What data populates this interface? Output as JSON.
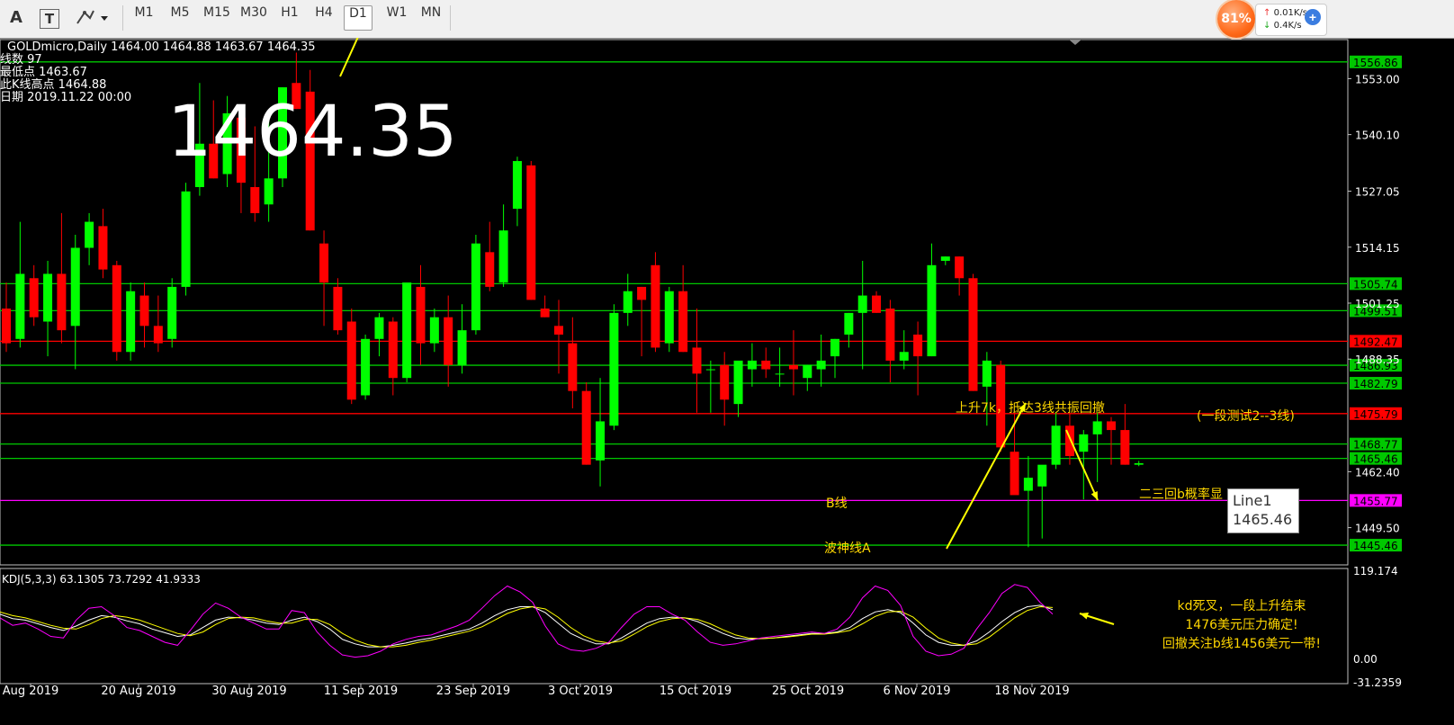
{
  "toolbar": {
    "text_tool_a": "A",
    "text_tool_t": "T",
    "timeframes": [
      "M1",
      "M5",
      "M15",
      "M30",
      "H1",
      "H4",
      "D1",
      "W1",
      "MN"
    ],
    "active_timeframe": "D1",
    "cpu_percent": "81%",
    "upload_rate": "0.01K/s",
    "download_rate": "0.4K/s",
    "plus": "+"
  },
  "info": {
    "symbol_line": "GOLDmicro,Daily  1464.00 1464.88 1463.67 1464.35",
    "line2": "线数  97",
    "line3": "最低点 1463.67",
    "line4": "此K线高点 1464.88",
    "line5": "日期 2019.11.22 00:00",
    "big_price": "1464.35"
  },
  "chart_data": [
    {
      "type": "candlestick",
      "symbol": "GOLDmicro",
      "period": "Daily",
      "ylim": [
        1440.5,
        1562.0
      ],
      "price_axis_ticks": [
        "1553.00",
        "1540.10",
        "1527.05",
        "1514.15",
        "1501.25",
        "1488.35",
        "1462.40",
        "1449.50"
      ],
      "date_labels": [
        {
          "index": 1,
          "label": "Aug 2019"
        },
        {
          "index": 9,
          "label": "20 Aug 2019"
        },
        {
          "index": 17,
          "label": "30 Aug 2019"
        },
        {
          "index": 25,
          "label": "11 Sep 2019"
        },
        {
          "index": 33,
          "label": "23 Sep 2019"
        },
        {
          "index": 41,
          "label": "3 Oct 2019"
        },
        {
          "index": 49,
          "label": "15 Oct 2019"
        },
        {
          "index": 57,
          "label": "25 Oct 2019"
        },
        {
          "index": 65,
          "label": "6 Nov 2019"
        },
        {
          "index": 73,
          "label": "18 Nov 2019"
        }
      ],
      "ohlc": [
        [
          1500,
          1506,
          1490,
          1492
        ],
        [
          1493,
          1520,
          1491,
          1508
        ],
        [
          1507,
          1510,
          1496,
          1498
        ],
        [
          1497,
          1511,
          1489,
          1508
        ],
        [
          1508,
          1522,
          1492,
          1495
        ],
        [
          1496,
          1517,
          1486,
          1514
        ],
        [
          1514,
          1522,
          1510,
          1520
        ],
        [
          1519,
          1523,
          1507,
          1509
        ],
        [
          1510,
          1511,
          1488,
          1490
        ],
        [
          1490,
          1506,
          1488,
          1504
        ],
        [
          1503,
          1506,
          1491,
          1496
        ],
        [
          1496,
          1503,
          1490,
          1492
        ],
        [
          1493,
          1507,
          1491,
          1505
        ],
        [
          1505,
          1529,
          1503,
          1527
        ],
        [
          1528,
          1552,
          1526,
          1538
        ],
        [
          1538,
          1548,
          1530,
          1530
        ],
        [
          1531,
          1549,
          1528,
          1545
        ],
        [
          1544,
          1546,
          1522,
          1529
        ],
        [
          1528,
          1542,
          1520,
          1522
        ],
        [
          1524,
          1544,
          1520,
          1530
        ],
        [
          1530,
          1551,
          1528,
          1551
        ],
        [
          1552,
          1559,
          1546,
          1546
        ],
        [
          1550,
          1555,
          1518,
          1518
        ],
        [
          1515,
          1518,
          1496,
          1506
        ],
        [
          1505,
          1507,
          1494,
          1495
        ],
        [
          1497,
          1500,
          1478,
          1479
        ],
        [
          1480,
          1494,
          1479,
          1493
        ],
        [
          1493,
          1499,
          1489,
          1498
        ],
        [
          1497,
          1498,
          1480,
          1484
        ],
        [
          1484,
          1497,
          1483,
          1506
        ],
        [
          1505,
          1510,
          1487,
          1492
        ],
        [
          1492,
          1500,
          1490,
          1498
        ],
        [
          1498,
          1503,
          1482,
          1487
        ],
        [
          1487,
          1501,
          1485,
          1495
        ],
        [
          1495,
          1517,
          1494,
          1515
        ],
        [
          1513,
          1520,
          1504,
          1505
        ],
        [
          1506,
          1524,
          1505,
          1518
        ],
        [
          1523,
          1535,
          1519,
          1534
        ],
        [
          1533,
          1534,
          1502,
          1502
        ],
        [
          1500,
          1503,
          1498,
          1498
        ],
        [
          1496,
          1502,
          1485,
          1494
        ],
        [
          1492,
          1498,
          1477,
          1481
        ],
        [
          1481,
          1483,
          1464,
          1464
        ],
        [
          1465,
          1484,
          1459,
          1474
        ],
        [
          1473,
          1501,
          1472,
          1499
        ],
        [
          1499,
          1508,
          1496,
          1504
        ],
        [
          1505,
          1505,
          1489,
          1502
        ],
        [
          1510,
          1513,
          1490,
          1491
        ],
        [
          1492,
          1505,
          1490,
          1504
        ],
        [
          1504,
          1510,
          1490,
          1490
        ],
        [
          1491,
          1500,
          1476,
          1485
        ],
        [
          1486,
          1488,
          1476,
          1486
        ],
        [
          1487,
          1490,
          1473,
          1479
        ],
        [
          1478,
          1485,
          1475,
          1488
        ],
        [
          1486,
          1492,
          1482,
          1488
        ],
        [
          1488,
          1491,
          1484,
          1486
        ],
        [
          1485,
          1491,
          1482,
          1485
        ],
        [
          1487,
          1495,
          1480,
          1486
        ],
        [
          1484,
          1487,
          1481,
          1487
        ],
        [
          1486,
          1494,
          1482,
          1488
        ],
        [
          1489,
          1493,
          1484,
          1493
        ],
        [
          1494,
          1499,
          1491,
          1499
        ],
        [
          1499,
          1511,
          1486,
          1503
        ],
        [
          1503,
          1504,
          1499,
          1499
        ],
        [
          1500,
          1502,
          1483,
          1488
        ],
        [
          1488,
          1495,
          1486,
          1490
        ],
        [
          1494,
          1497,
          1480,
          1489
        ],
        [
          1489,
          1515,
          1489,
          1510
        ],
        [
          1511,
          1512,
          1510,
          1512
        ],
        [
          1512,
          1512,
          1503,
          1507
        ],
        [
          1507,
          1508,
          1481,
          1481
        ],
        [
          1482,
          1490,
          1473,
          1488
        ],
        [
          1487,
          1488,
          1467,
          1468
        ],
        [
          1467,
          1476,
          1458,
          1457
        ],
        [
          1458,
          1466,
          1445,
          1461
        ]
      ],
      "ohlc_note": "",
      "candles_extra": [
        [
          1459,
          1463,
          1447,
          1464
        ],
        [
          1464,
          1476,
          1463,
          1473
        ],
        [
          1473,
          1476,
          1464,
          1466
        ],
        [
          1467,
          1472,
          1456,
          1471
        ],
        [
          1471,
          1476,
          1460,
          1474
        ],
        [
          1474,
          1475,
          1464,
          1472
        ],
        [
          1472,
          1478,
          1464,
          1464
        ],
        [
          1464.0,
          1464.88,
          1463.67,
          1464.35
        ]
      ],
      "horizontal_lines": [
        {
          "price": 1556.86,
          "label": "1556.86",
          "color": "#00c800"
        },
        {
          "price": 1505.74,
          "label": "1505.74",
          "color": "#00c800"
        },
        {
          "price": 1499.51,
          "label": "1499.51",
          "color": "#00c800"
        },
        {
          "price": 1492.47,
          "label": "1492.47",
          "color": "#ff0000"
        },
        {
          "price": 1486.93,
          "label": "1486.93",
          "color": "#00c800"
        },
        {
          "price": 1482.79,
          "label": "1482.79",
          "color": "#00c800"
        },
        {
          "price": 1475.79,
          "label": "1475.79",
          "color": "#ff0000"
        },
        {
          "price": 1468.77,
          "label": "1468.77",
          "color": "#00c800"
        },
        {
          "price": 1465.46,
          "label": "1465.46",
          "color": "#00c800"
        },
        {
          "price": 1455.77,
          "label": "1455.77",
          "color": "#ff00ff"
        },
        {
          "price": 1445.46,
          "label": "1445.46",
          "color": "#00c800"
        }
      ],
      "annotations": [
        {
          "text": "上升7k，抵达3线共振回撤",
          "color": "#ffd700"
        },
        {
          "text": "(一段测试2--3线)",
          "color": "#ffd700"
        },
        {
          "text": "二三回b概率显",
          "color": "#ffd700"
        },
        {
          "text": "B线",
          "color": "#ffd700"
        },
        {
          "text": "波神线A",
          "color": "#ffd700"
        }
      ],
      "tooltip": {
        "name": "Line1",
        "value": "1465.46"
      },
      "up_color": "#00ff00",
      "down_color": "#ff0000"
    },
    {
      "type": "line",
      "title": "KDJ(5,3,3) 63.1305 73.7292 41.9333",
      "ylim": [
        -31.2359,
        119.174
      ],
      "axis_ticks": [
        "119.174",
        "0.00",
        "-31.2359"
      ],
      "series": [
        {
          "color": "#ffffff",
          "values": [
            60,
            54,
            52,
            47,
            42,
            38,
            44,
            52,
            58,
            56,
            51,
            47,
            40,
            35,
            30,
            32,
            42,
            52,
            56,
            55,
            52,
            48,
            46,
            52,
            56,
            50,
            40,
            26,
            20,
            16,
            16,
            18,
            21,
            25,
            28,
            32,
            36,
            40,
            48,
            58,
            66,
            70,
            70,
            62,
            48,
            34,
            26,
            20,
            20,
            28,
            38,
            48,
            54,
            56,
            55,
            50,
            42,
            34,
            28,
            26,
            27,
            28,
            30,
            32,
            34,
            34,
            36,
            42,
            54,
            63,
            66,
            62,
            48,
            32,
            22,
            18,
            18,
            24,
            36,
            50,
            62,
            70,
            72,
            66
          ]
        },
        {
          "color": "#ffff00",
          "values": [
            63,
            58,
            55,
            50,
            45,
            41,
            40,
            46,
            54,
            58,
            56,
            52,
            46,
            40,
            34,
            31,
            36,
            46,
            54,
            56,
            55,
            51,
            48,
            48,
            53,
            53,
            46,
            34,
            25,
            19,
            16,
            16,
            18,
            22,
            25,
            29,
            33,
            37,
            43,
            52,
            61,
            67,
            70,
            67,
            56,
            42,
            31,
            24,
            21,
            24,
            33,
            43,
            50,
            54,
            55,
            53,
            47,
            39,
            32,
            28,
            27,
            28,
            29,
            31,
            33,
            33,
            35,
            38,
            47,
            57,
            63,
            64,
            56,
            41,
            28,
            21,
            18,
            20,
            29,
            42,
            55,
            65,
            70,
            69
          ]
        },
        {
          "color": "#ff00ff",
          "values": [
            55,
            45,
            48,
            40,
            30,
            28,
            52,
            68,
            70,
            58,
            42,
            38,
            30,
            22,
            18,
            38,
            60,
            75,
            68,
            56,
            48,
            40,
            40,
            65,
            62,
            36,
            18,
            5,
            2,
            4,
            10,
            20,
            26,
            30,
            32,
            38,
            44,
            52,
            68,
            85,
            98,
            90,
            76,
            44,
            20,
            12,
            10,
            14,
            22,
            42,
            60,
            70,
            70,
            60,
            52,
            36,
            22,
            18,
            20,
            24,
            28,
            30,
            32,
            34,
            36,
            34,
            40,
            56,
            82,
            98,
            92,
            72,
            30,
            10,
            4,
            6,
            14,
            40,
            62,
            88,
            100,
            96,
            76,
            60
          ]
        }
      ]
    }
  ],
  "kdj_annotation": [
    "kd死叉，一段上升结束",
    "1476美元压力确定!",
    "回撤关注b线1456美元一带!"
  ]
}
